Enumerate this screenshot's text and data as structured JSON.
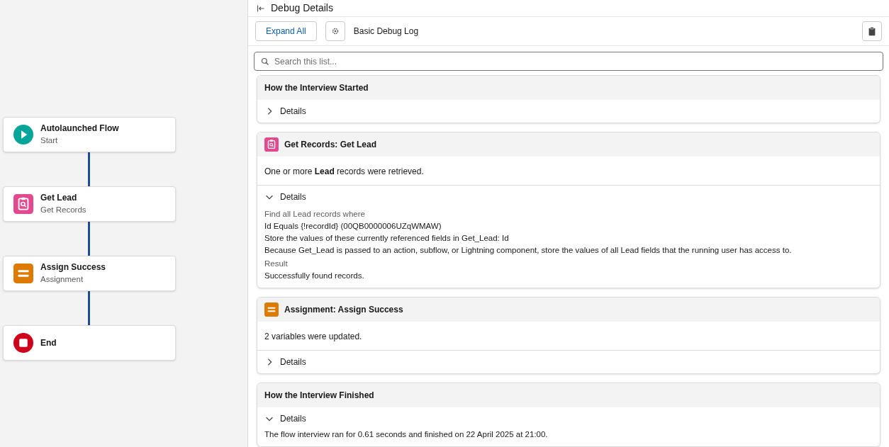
{
  "flow_nodes": [
    {
      "kind": "start",
      "title": "Autolaunched Flow",
      "subtitle": "Start"
    },
    {
      "kind": "get_records",
      "title": "Get Lead",
      "subtitle": "Get Records"
    },
    {
      "kind": "assignment",
      "title": "Assign Success",
      "subtitle": "Assignment"
    },
    {
      "kind": "end",
      "title": "End"
    }
  ],
  "panel": {
    "title": "Debug Details",
    "expand_button": "Expand All",
    "log_label": "Basic Debug Log",
    "search": {
      "placeholder": "Search this list..."
    }
  },
  "sections": [
    {
      "kind": "plain",
      "title": "How the Interview Started",
      "details": {
        "label": "Details",
        "expanded": false
      }
    },
    {
      "kind": "get_records",
      "title": "Get Records: Get Lead",
      "summary": "One or more **Lead** records were retrieved.",
      "details": {
        "label": "Details",
        "expanded": true,
        "lines": [
          {
            "kind": "label",
            "text": "Find all Lead records where"
          },
          {
            "kind": "value",
            "text": "Id Equals {!recordId} (00QB0000006UZqWMAW)"
          },
          {
            "kind": "value",
            "text": "Store the values of these currently referenced fields in Get_Lead: Id"
          },
          {
            "kind": "value",
            "text": "Because Get_Lead is passed to an action, subflow, or Lightning component, store the values of all Lead fields that the running user has access to."
          },
          {
            "kind": "label",
            "text": "Result"
          },
          {
            "kind": "value",
            "text": "Successfully found records."
          }
        ]
      }
    },
    {
      "kind": "assignment",
      "title": "Assignment: Assign Success",
      "summary": "2 variables were updated.",
      "details": {
        "label": "Details",
        "expanded": false
      }
    },
    {
      "kind": "plain",
      "title": "How the Interview Finished",
      "details": {
        "label": "Details",
        "expanded": true,
        "lines": [
          {
            "kind": "value",
            "text": "The flow interview ran for 0.61 seconds and finished on 22 April 2025 at 21:00."
          }
        ]
      }
    }
  ]
}
